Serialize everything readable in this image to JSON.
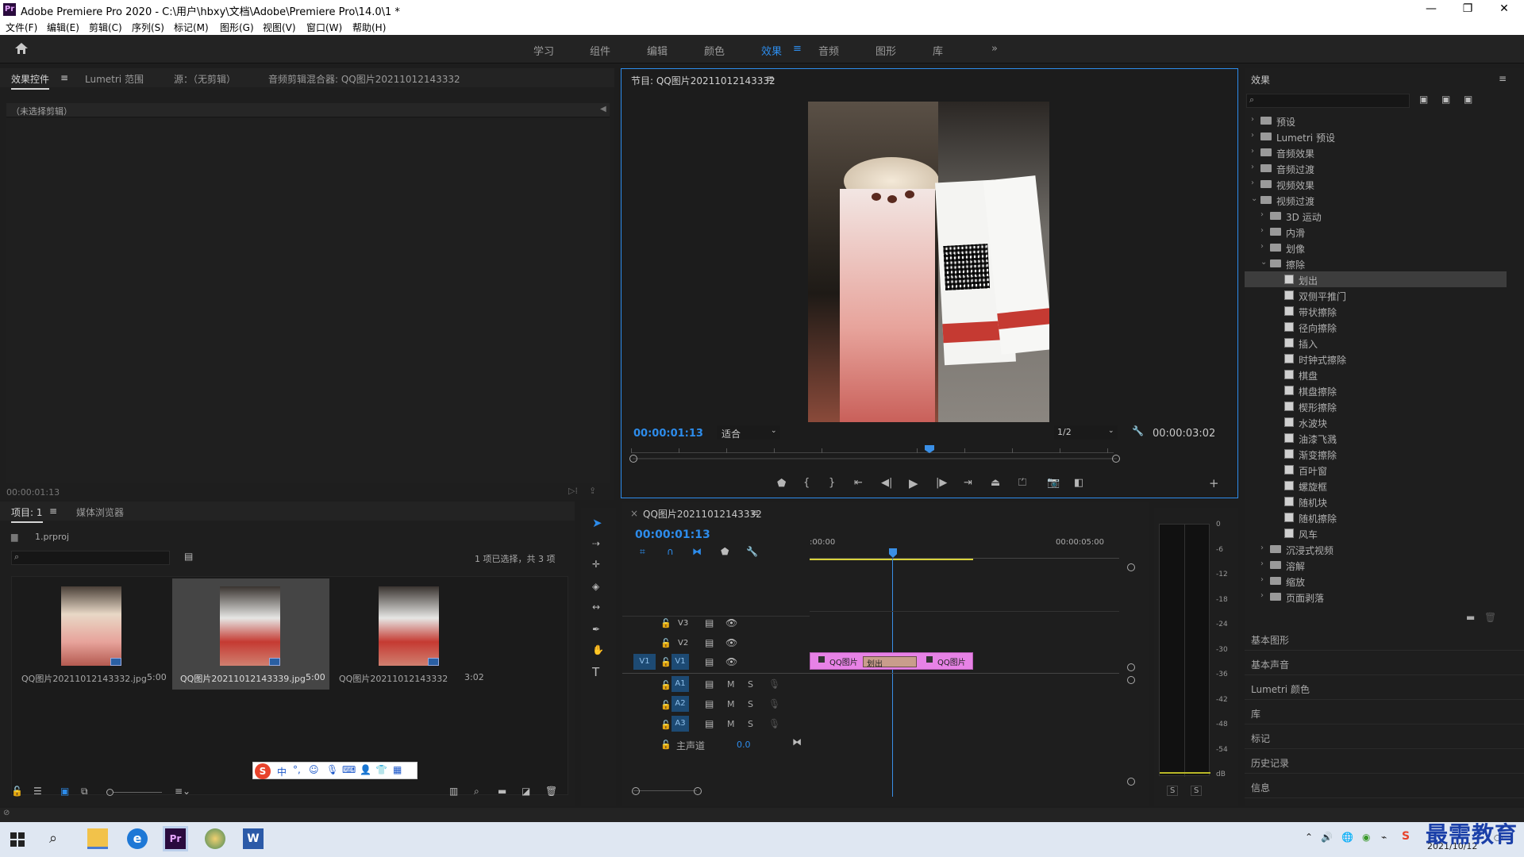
{
  "window": {
    "title": "Adobe Premiere Pro 2020 - C:\\用户\\hbxy\\文档\\Adobe\\Premiere Pro\\14.0\\1 *"
  },
  "menu": [
    "文件(F)",
    "编辑(E)",
    "剪辑(C)",
    "序列(S)",
    "标记(M)",
    "图形(G)",
    "视图(V)",
    "窗口(W)",
    "帮助(H)"
  ],
  "workspaces": [
    "学习",
    "组件",
    "编辑",
    "颜色",
    "效果",
    "音频",
    "图形",
    "库"
  ],
  "effect_controls": {
    "tabs": [
      "效果控件",
      "Lumetri 范围",
      "源：（无剪辑）",
      "音频剪辑混合器: QQ图片20211012143332"
    ],
    "no_clip": "（未选择剪辑）",
    "timecode": "00:00:01:13"
  },
  "program": {
    "title": "节目: QQ图片20211012143332",
    "timecode": "00:00:01:13",
    "fit": "适合",
    "resolution": "1/2",
    "duration": "00:00:03:02"
  },
  "effects": {
    "title": "效果",
    "tree": [
      {
        "label": "预设",
        "level": 0,
        "type": "folder",
        "open": false
      },
      {
        "label": "Lumetri 预设",
        "level": 0,
        "type": "folder",
        "open": false
      },
      {
        "label": "音频效果",
        "level": 0,
        "type": "folder",
        "open": false
      },
      {
        "label": "音频过渡",
        "level": 0,
        "type": "folder",
        "open": false
      },
      {
        "label": "视频效果",
        "level": 0,
        "type": "folder",
        "open": false
      },
      {
        "label": "视频过渡",
        "level": 0,
        "type": "folder",
        "open": true
      },
      {
        "label": "3D 运动",
        "level": 1,
        "type": "folder",
        "open": false
      },
      {
        "label": "内滑",
        "level": 1,
        "type": "folder",
        "open": false
      },
      {
        "label": "划像",
        "level": 1,
        "type": "folder",
        "open": false
      },
      {
        "label": "擦除",
        "level": 1,
        "type": "folder",
        "open": true
      },
      {
        "label": "划出",
        "level": 2,
        "type": "fx",
        "selected": true
      },
      {
        "label": "双侧平推门",
        "level": 2,
        "type": "fx"
      },
      {
        "label": "带状擦除",
        "level": 2,
        "type": "fx"
      },
      {
        "label": "径向擦除",
        "level": 2,
        "type": "fx"
      },
      {
        "label": "插入",
        "level": 2,
        "type": "fx"
      },
      {
        "label": "时钟式擦除",
        "level": 2,
        "type": "fx"
      },
      {
        "label": "棋盘",
        "level": 2,
        "type": "fx"
      },
      {
        "label": "棋盘擦除",
        "level": 2,
        "type": "fx"
      },
      {
        "label": "楔形擦除",
        "level": 2,
        "type": "fx"
      },
      {
        "label": "水波块",
        "level": 2,
        "type": "fx"
      },
      {
        "label": "油漆飞溅",
        "level": 2,
        "type": "fx"
      },
      {
        "label": "渐变擦除",
        "level": 2,
        "type": "fx"
      },
      {
        "label": "百叶窗",
        "level": 2,
        "type": "fx"
      },
      {
        "label": "螺旋框",
        "level": 2,
        "type": "fx"
      },
      {
        "label": "随机块",
        "level": 2,
        "type": "fx"
      },
      {
        "label": "随机擦除",
        "level": 2,
        "type": "fx"
      },
      {
        "label": "风车",
        "level": 2,
        "type": "fx"
      },
      {
        "label": "沉浸式视频",
        "level": 1,
        "type": "folder",
        "open": false
      },
      {
        "label": "溶解",
        "level": 1,
        "type": "folder",
        "open": false
      },
      {
        "label": "缩放",
        "level": 1,
        "type": "folder",
        "open": false
      },
      {
        "label": "页面剥落",
        "level": 1,
        "type": "folder",
        "open": false
      }
    ],
    "collapsed": [
      "基本图形",
      "基本声音",
      "Lumetri 颜色",
      "库",
      "标记",
      "历史记录",
      "信息"
    ]
  },
  "project": {
    "tabs": [
      "项目: 1",
      "媒体浏览器"
    ],
    "file": "1.prproj",
    "selection": "1 项已选择，共 3 项",
    "items": [
      {
        "name": "QQ图片20211012143332.jpg",
        "dur": "5:00"
      },
      {
        "name": "QQ图片20211012143339.jpg",
        "dur": "5:00",
        "selected": true
      },
      {
        "name": "QQ图片20211012143332",
        "dur": "3:02"
      }
    ]
  },
  "timeline": {
    "tab": "QQ图片20211012143332",
    "timecode": "00:00:01:13",
    "ruler": [
      ":00:00",
      "00:00:05:00"
    ],
    "video_tracks": [
      "V3",
      "V2",
      "V1"
    ],
    "audio_tracks": [
      "A1",
      "A2",
      "A3"
    ],
    "source_patch": "V1",
    "mute": "M",
    "solo": "S",
    "master": "主声道",
    "master_val": "0.0",
    "clip_a": "QQ图片",
    "clip_b": "QQ图片",
    "transition": "划出"
  },
  "meter": {
    "scale": [
      "0",
      "-6",
      "-12",
      "-18",
      "-24",
      "-30",
      "-36",
      "-42",
      "-48",
      "-54",
      "dB"
    ],
    "solo": "S"
  },
  "ime": {
    "lang": "中"
  },
  "taskbar": {
    "date": "2021/10/12"
  },
  "watermark": "最需教育",
  "colors": {
    "accent": "#2d8ceb",
    "clip": "#e782e6",
    "playhead": "#3a8fe6",
    "selected_bg": "#3d3d3d"
  }
}
